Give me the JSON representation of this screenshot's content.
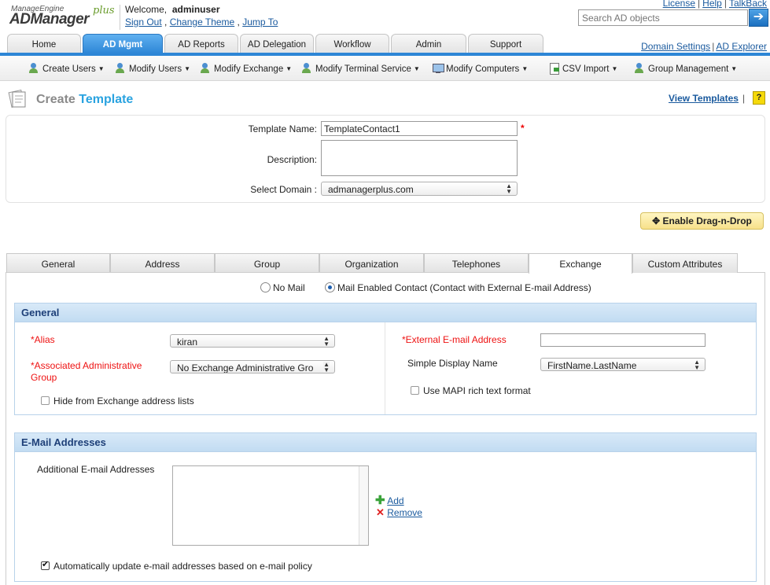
{
  "header": {
    "logo_top": "ManageEngine",
    "logo_main": "ADManager",
    "logo_plus": "plus",
    "welcome_label": "Welcome,",
    "username": "adminuser",
    "sign_out": "Sign Out",
    "change_theme": "Change Theme",
    "jump_to": "Jump To",
    "top_links": {
      "license": "License",
      "help": "Help",
      "talkback": "TalkBack"
    },
    "search_placeholder": "Search AD objects"
  },
  "main_tabs": [
    "Home",
    "AD Mgmt",
    "AD Reports",
    "AD Delegation",
    "Workflow",
    "Admin",
    "Support"
  ],
  "tab_links": {
    "domain_settings": "Domain Settings",
    "ad_explorer": "AD Explorer"
  },
  "subbar": [
    "Create Users",
    "Modify Users",
    "Modify Exchange",
    "Modify Terminal Service",
    "Modify Computers",
    "CSV Import",
    "Group Management"
  ],
  "page": {
    "title_a": "Create",
    "title_b": "Template",
    "view_templates": "View Templates",
    "help": "?"
  },
  "form": {
    "template_name_label": "Template Name:",
    "template_name_value": "TemplateContact1",
    "required_star": "*",
    "description_label": "Description:",
    "description_value": "",
    "domain_label": "Select Domain :",
    "domain_value": "admanagerplus.com"
  },
  "drag_drop": "Enable Drag-n-Drop",
  "inner_tabs": [
    "General",
    "Address",
    "Group",
    "Organization",
    "Telephones",
    "Exchange",
    "Custom Attributes"
  ],
  "mail": {
    "no_mail": "No Mail",
    "mail_enabled": "Mail Enabled Contact (Contact with External E-mail Address)"
  },
  "general_section": {
    "header": "General",
    "alias_label": "*Alias",
    "alias_value": "kiran",
    "admin_group_label": "*Associated Administrative Group",
    "admin_group_value": "No Exchange Administrative Gro",
    "hide_label": "Hide from Exchange address lists",
    "ext_email_label": "*External E-mail Address",
    "ext_email_value": "",
    "display_name_label": "Simple Display Name",
    "display_name_value": "FirstName.LastName",
    "mapi_label": "Use MAPI rich text format"
  },
  "email_section": {
    "header": "E-Mail Addresses",
    "additional_label": "Additional E-mail Addresses",
    "add": "Add",
    "remove": "Remove",
    "auto_update_label": "Automatically update e-mail addresses based on e-mail policy"
  },
  "colors": {
    "accent": "#2d86d6",
    "section_header": "#c2dcf2",
    "required": "#e11111"
  }
}
